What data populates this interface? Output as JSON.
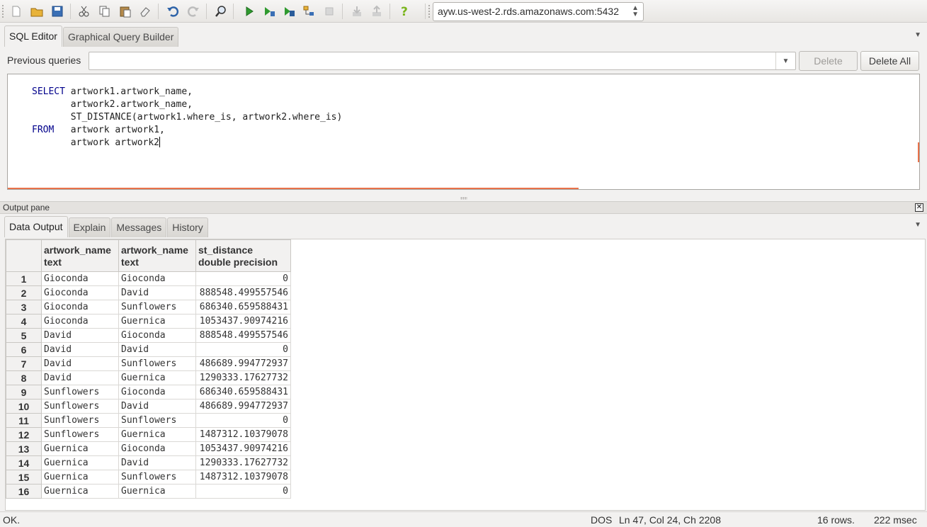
{
  "toolbar": {
    "connection": "ayw.us-west-2.rds.amazonaws.com:5432",
    "icons": [
      "new-file",
      "open-folder",
      "save",
      "cut",
      "copy",
      "paste",
      "clear",
      "undo",
      "redo",
      "find",
      "execute",
      "execute-pgscript",
      "execute-to-file",
      "explain",
      "cancel",
      "download",
      "upload",
      "help"
    ]
  },
  "editor_tabs": [
    "SQL Editor",
    "Graphical Query Builder"
  ],
  "previous_queries": {
    "label": "Previous queries",
    "value": "",
    "delete_label": "Delete",
    "delete_all_label": "Delete All"
  },
  "sql": {
    "lines": [
      {
        "kw": "SELECT",
        "text": " artwork1.artwork_name,"
      },
      {
        "kw": "",
        "text": "       artwork2.artwork_name,"
      },
      {
        "kw": "",
        "text": "       ST_DISTANCE(artwork1.where_is, artwork2.where_is)"
      },
      {
        "kw": "FROM",
        "text": "   artwork artwork1,"
      },
      {
        "kw": "",
        "text": "       artwork artwork2"
      }
    ]
  },
  "output": {
    "title": "Output pane",
    "tabs": [
      "Data Output",
      "Explain",
      "Messages",
      "History"
    ],
    "columns": [
      {
        "name": "artwork_name",
        "type": "text"
      },
      {
        "name": "artwork_name",
        "type": "text"
      },
      {
        "name": "st_distance",
        "type": "double precision"
      }
    ],
    "rows": [
      [
        "1",
        "Gioconda",
        "Gioconda",
        "0"
      ],
      [
        "2",
        "Gioconda",
        "David",
        "888548.499557546"
      ],
      [
        "3",
        "Gioconda",
        "Sunflowers",
        "686340.659588431"
      ],
      [
        "4",
        "Gioconda",
        "Guernica",
        "1053437.90974216"
      ],
      [
        "5",
        "David",
        "Gioconda",
        "888548.499557546"
      ],
      [
        "6",
        "David",
        "David",
        "0"
      ],
      [
        "7",
        "David",
        "Sunflowers",
        "486689.994772937"
      ],
      [
        "8",
        "David",
        "Guernica",
        "1290333.17627732"
      ],
      [
        "9",
        "Sunflowers",
        "Gioconda",
        "686340.659588431"
      ],
      [
        "10",
        "Sunflowers",
        "David",
        "486689.994772937"
      ],
      [
        "11",
        "Sunflowers",
        "Sunflowers",
        "0"
      ],
      [
        "12",
        "Sunflowers",
        "Guernica",
        "1487312.10379078"
      ],
      [
        "13",
        "Guernica",
        "Gioconda",
        "1053437.90974216"
      ],
      [
        "14",
        "Guernica",
        "David",
        "1290333.17627732"
      ],
      [
        "15",
        "Guernica",
        "Sunflowers",
        "1487312.10379078"
      ],
      [
        "16",
        "Guernica",
        "Guernica",
        "0"
      ]
    ]
  },
  "status": {
    "message": "OK.",
    "line_ending": "DOS",
    "position": "Ln 47, Col 24, Ch 2208",
    "rows": "16 rows.",
    "time": "222 msec"
  }
}
